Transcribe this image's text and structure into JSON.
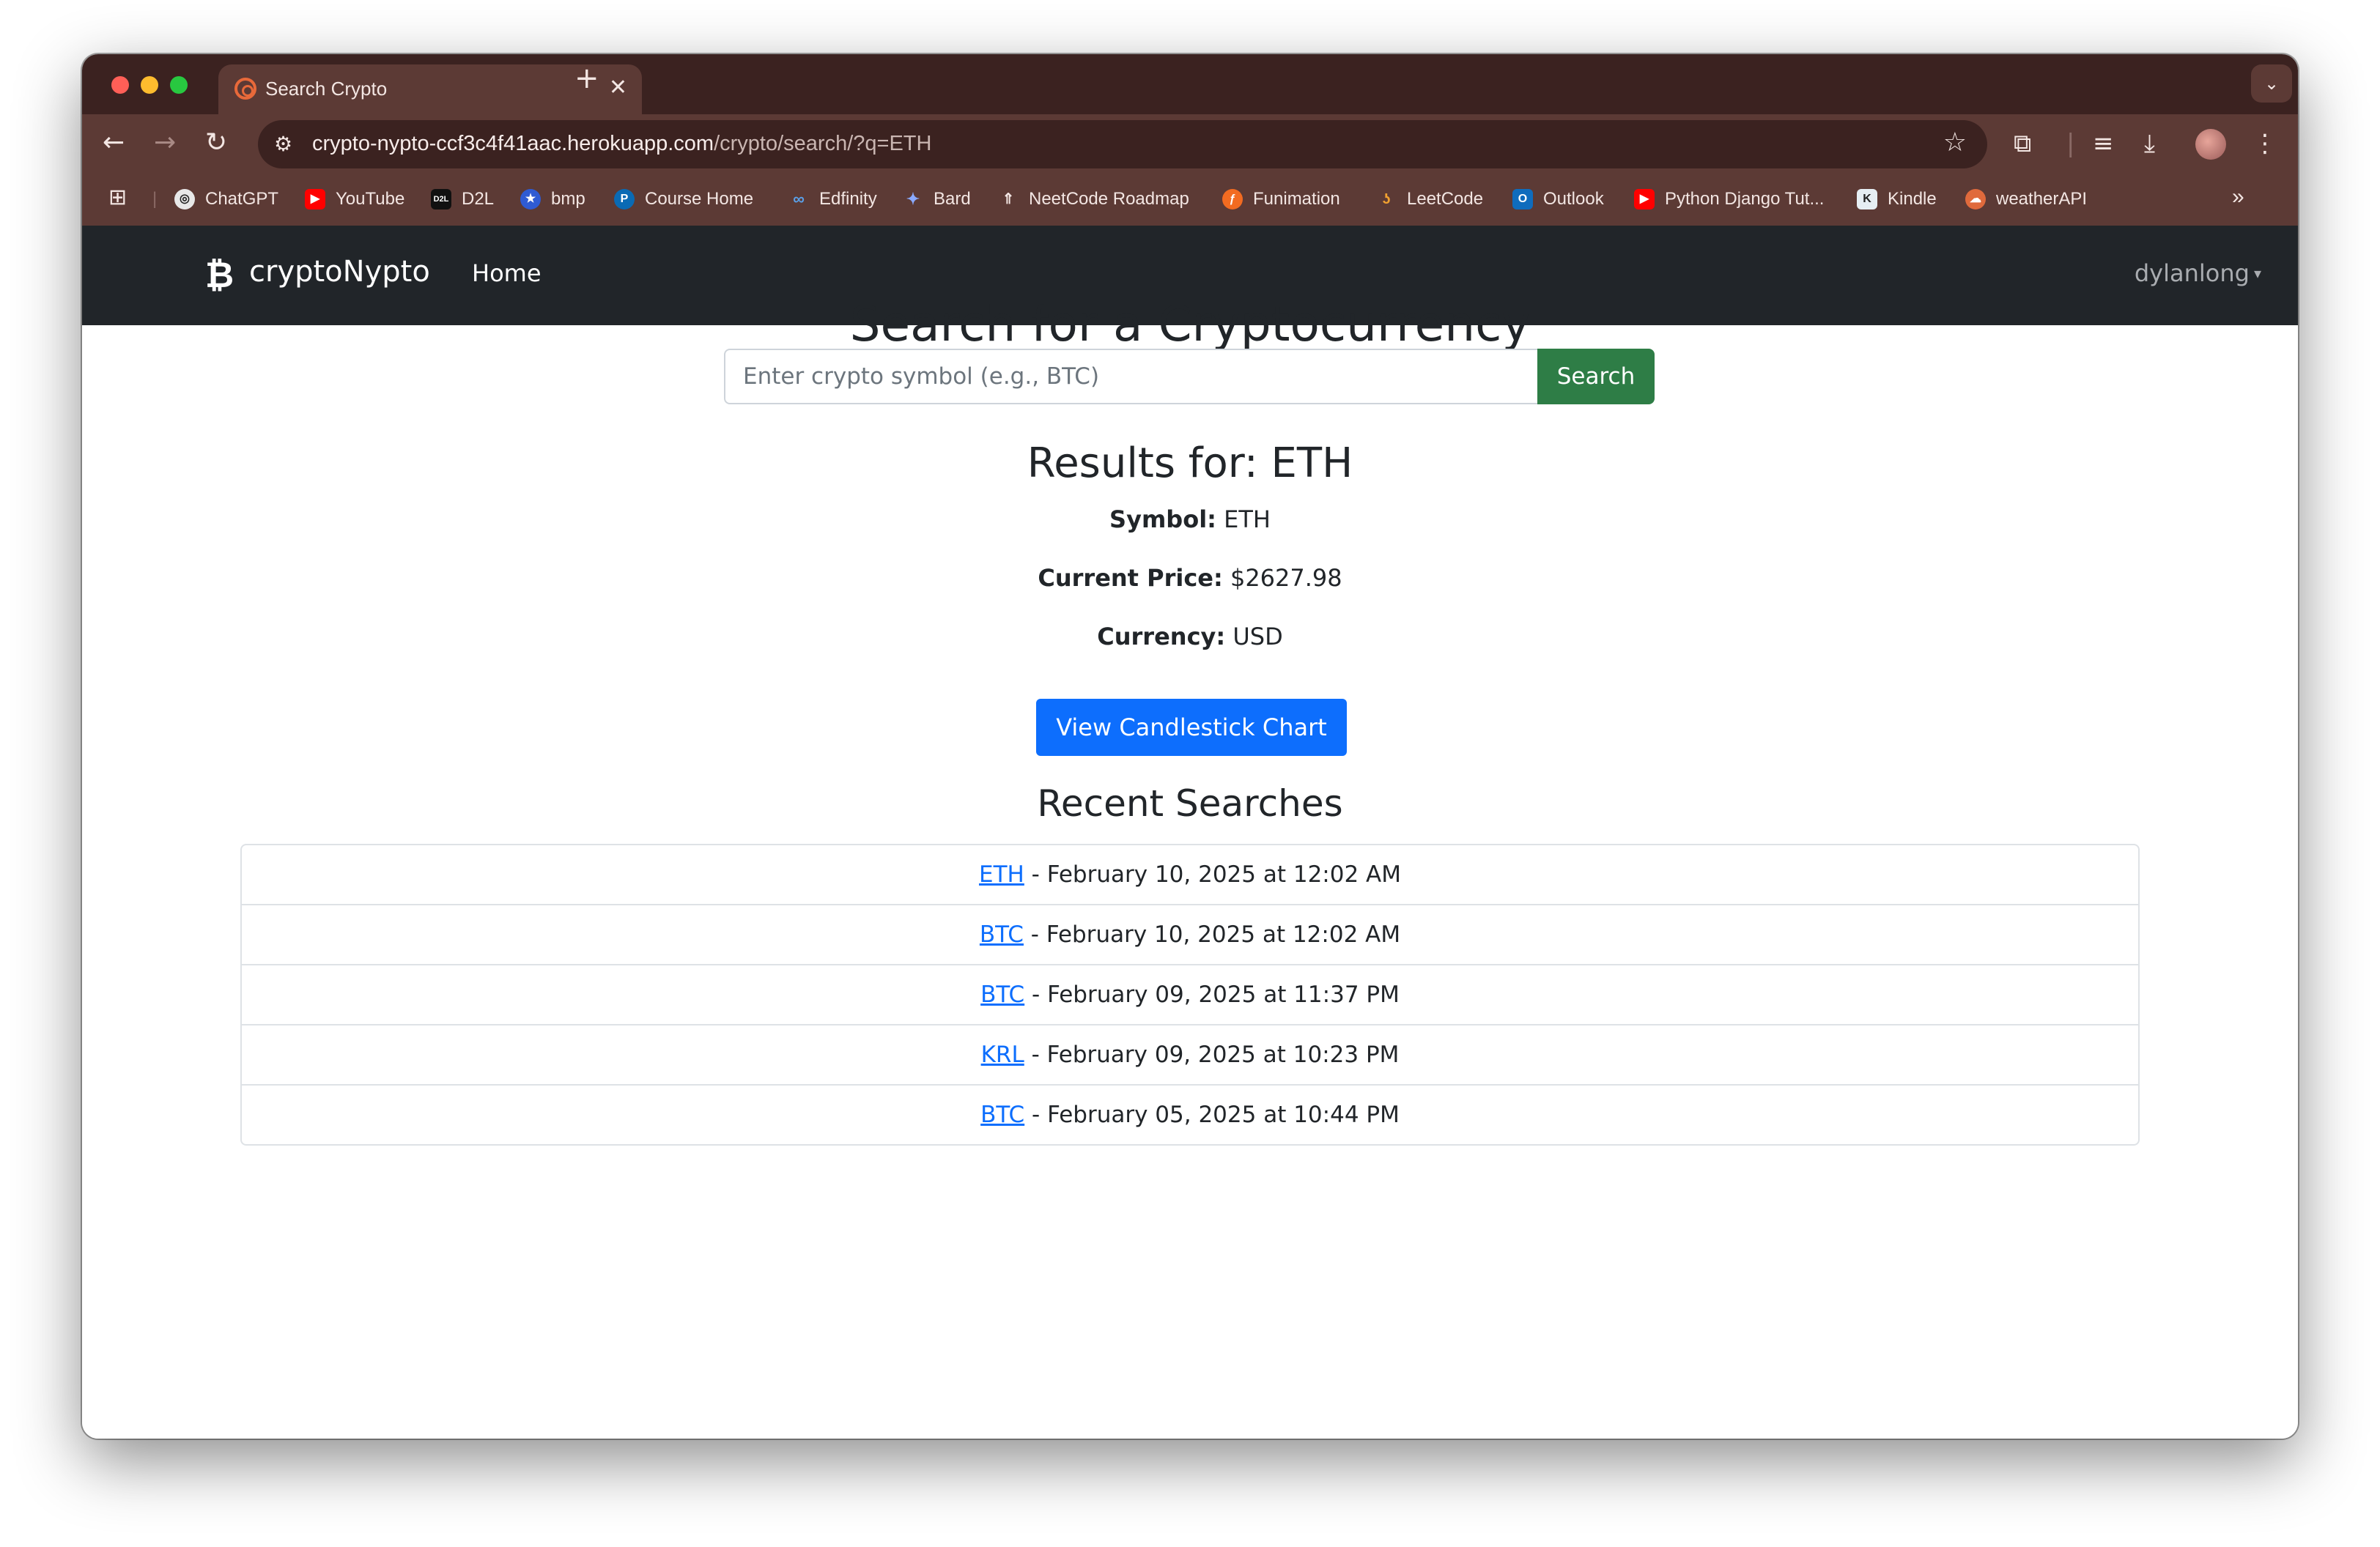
{
  "browser": {
    "tab_title": "Search Crypto",
    "tab_close": "✕",
    "new_tab": "+",
    "url_host": "crypto-nypto-ccf3c4f41aac.herokuapp.com",
    "url_path": "/crypto/search/?q=ETH",
    "bookmarks": [
      {
        "label": "ChatGPT",
        "icon": "chatgpt-icon"
      },
      {
        "label": "YouTube",
        "icon": "youtube-icon"
      },
      {
        "label": "D2L",
        "icon": "d2l-icon"
      },
      {
        "label": "bmp",
        "icon": "star-badge-icon"
      },
      {
        "label": "Course Home",
        "icon": "pearson-icon"
      },
      {
        "label": "Edfinity",
        "icon": "infinity-icon"
      },
      {
        "label": "Bard",
        "icon": "sparkle-icon"
      },
      {
        "label": "NeetCode Roadmap",
        "icon": "rocket-icon"
      },
      {
        "label": "Funimation",
        "icon": "funimation-icon"
      },
      {
        "label": "LeetCode",
        "icon": "leetcode-icon"
      },
      {
        "label": "Outlook",
        "icon": "outlook-icon"
      },
      {
        "label": "Python Django Tut...",
        "icon": "youtube-icon"
      },
      {
        "label": "Kindle",
        "icon": "kindle-icon"
      },
      {
        "label": "weatherAPI",
        "icon": "weather-icon"
      }
    ],
    "more_bookmarks": "»"
  },
  "nav": {
    "brand": "cryptoNypto",
    "brand_icon": "₿",
    "home": "Home",
    "user": "dylanlong",
    "caret": "▾"
  },
  "main": {
    "title": "Search for a Cryptocurrency",
    "search_placeholder": "Enter crypto symbol (e.g., BTC)",
    "search_value": "",
    "search_button": "Search",
    "results_title": "Results for: ETH",
    "symbol_label": "Symbol:",
    "symbol_value": "ETH",
    "price_label": "Current Price:",
    "price_value": "$2627.98",
    "currency_label": "Currency:",
    "currency_value": "USD",
    "chart_button": "View Candlestick Chart",
    "recent_title": "Recent Searches",
    "recent": [
      {
        "symbol": "ETH",
        "time": " - February 10, 2025 at 12:02 AM"
      },
      {
        "symbol": "BTC",
        "time": " - February 10, 2025 at 12:02 AM"
      },
      {
        "symbol": "BTC",
        "time": " - February 09, 2025 at 11:37 PM"
      },
      {
        "symbol": "KRL",
        "time": " - February 09, 2025 at 10:23 PM"
      },
      {
        "symbol": "BTC",
        "time": " - February 05, 2025 at 10:44 PM"
      }
    ]
  },
  "colors": {
    "navbar": "#212529",
    "search_button": "#2e7d46",
    "primary": "#0d6efd",
    "browser_frame": "#5c3a35"
  }
}
